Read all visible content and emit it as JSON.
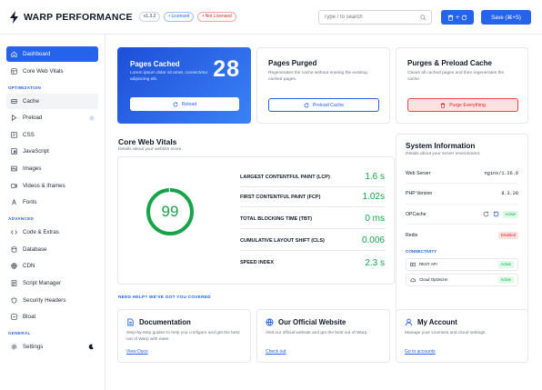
{
  "app": {
    "name": "WARP PERFORMANCE",
    "version": "v1.3.2",
    "licensed": "• Licensed",
    "not_licensed": "• Not Licensed"
  },
  "search": {
    "placeholder": "Type / to search"
  },
  "toolbar": {
    "icon_button": "⇣ + ↻",
    "save_label": "Save (⌘+S)"
  },
  "sidebar": {
    "items_top": [
      {
        "label": "Dashboard"
      },
      {
        "label": "Core Web Vitals"
      }
    ],
    "sections": [
      {
        "title": "OPTIMIZATION",
        "items": [
          {
            "label": "Cache"
          },
          {
            "label": "Preload",
            "badge": "i"
          },
          {
            "label": "CSS"
          },
          {
            "label": "JavaScript"
          },
          {
            "label": "Images"
          },
          {
            "label": "Videos & iframes"
          },
          {
            "label": "Fonts"
          }
        ]
      },
      {
        "title": "ADVANCED",
        "items": [
          {
            "label": "Code & Extras"
          },
          {
            "label": "Database"
          },
          {
            "label": "CDN"
          },
          {
            "label": "Script Manager"
          },
          {
            "label": "Security Headers"
          },
          {
            "label": "Bloat"
          }
        ]
      },
      {
        "title": "GENERAL",
        "items": [
          {
            "label": "Settings"
          }
        ]
      }
    ]
  },
  "cards": {
    "cached": {
      "title": "Pages Cached",
      "desc": "Lorem ipsum dolor sit amet, consectetur adipiscing elit.",
      "count": "28",
      "button": "Reload"
    },
    "purged": {
      "title": "Pages Purged",
      "desc": "Regenerates the cache without erasing the existing cached pages.",
      "button": "Preload Cache"
    },
    "purge_preload": {
      "title": "Purges & Preload Cache",
      "desc": "Clears all cached pages and then regenerates the cache.",
      "button": "Purge Everything"
    }
  },
  "cwv": {
    "title": "Core Web Vitals",
    "subtitle": "Details about your website score.",
    "score": "99",
    "metrics": [
      {
        "label": "LARGEST CONTENTFUL PAINT (LCP)",
        "value": "1.6 s"
      },
      {
        "label": "FIRST CONTENTFUL PAINT (FCP)",
        "value": "1.02s"
      },
      {
        "label": "TOTAL BLOCKING TIME (TBT)",
        "value": "0 ms"
      },
      {
        "label": "CUMULATIVE LAYOUT SHIFT (CLS)",
        "value": "0.006"
      },
      {
        "label": "SPEED INDEX",
        "value": "2.3 s"
      }
    ]
  },
  "sysinfo": {
    "title": "System Information",
    "subtitle": "Details about your server environment.",
    "rows": [
      {
        "label": "Web Server",
        "value": "nginx/1.26.0"
      },
      {
        "label": "PHP Version",
        "value": "8.3.28"
      },
      {
        "label": "OPCache",
        "value": "Active"
      },
      {
        "label": "Redis",
        "value": "Disabled"
      }
    ],
    "connectivity_title": "CONNECTIVITY",
    "connectivity": [
      {
        "label": "REST API",
        "status": "Active"
      },
      {
        "label": "Cloud Optimizer",
        "status": "Active"
      }
    ]
  },
  "help": {
    "section_title": "NEED HELP? WE'VE GOT YOU COVERED",
    "cards": [
      {
        "title": "Documentation",
        "desc": "Step-by-step guides to help you configure and get the best out of Warp with ease.",
        "link": "View Docs"
      },
      {
        "title": "Our Official Website",
        "desc": "Visit our official website and get the best out of Warp",
        "link": "Check out"
      },
      {
        "title": "My Account",
        "desc": "Manage your Licenses and cloud settings.",
        "link": "Go to accounts"
      }
    ]
  },
  "colors": {
    "accent": "#2563eb",
    "success": "#16a34a",
    "danger": "#dc2626"
  }
}
